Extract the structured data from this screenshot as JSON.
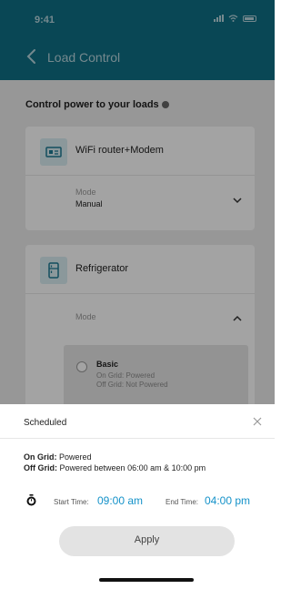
{
  "status": {
    "time": "9:41"
  },
  "header": {
    "title": "Load Control"
  },
  "section": {
    "title": "Control power to your loads"
  },
  "loads": [
    {
      "name": "WiFi router+Modem",
      "mode_label": "Mode",
      "mode_value": "Manual"
    },
    {
      "name": "Refrigerator",
      "mode_label": "Mode"
    }
  ],
  "mode_option": {
    "title": "Basic",
    "line1": "On Grid: Powered",
    "line2": "Off Grid: Not Powered"
  },
  "sheet": {
    "title": "Scheduled",
    "on_grid_label": "On Grid:",
    "on_grid_value": "Powered",
    "off_grid_label": "Off Grid:",
    "off_grid_value": "Powered between 06:00 am & 10:00 pm",
    "start_label": "Start Time:",
    "start_value": "09:00 am",
    "end_label": "End Time:",
    "end_value": "04:00 pm",
    "apply_label": "Apply"
  },
  "colors": {
    "header": "#0f6f86",
    "accent": "#1592c9",
    "text": "#222222"
  },
  "icons": [
    "back-chevron-icon",
    "info-icon",
    "router-icon",
    "refrigerator-icon",
    "chevron-down-icon",
    "chevron-up-icon",
    "close-icon",
    "timer-icon"
  ]
}
